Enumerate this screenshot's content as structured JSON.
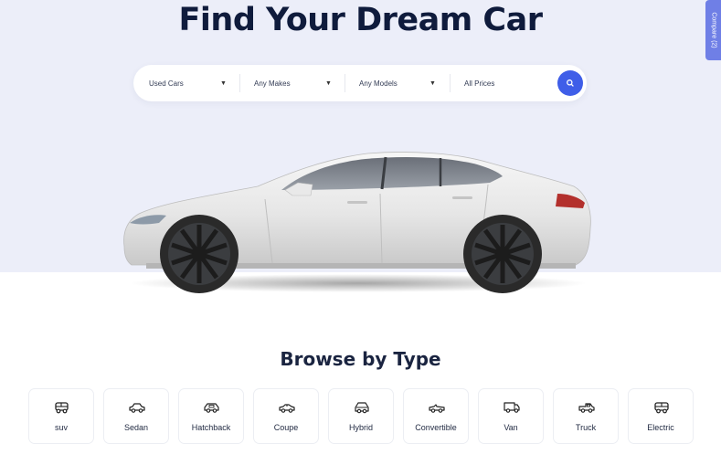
{
  "hero": {
    "title": "Find Your Dream Car"
  },
  "compare_tab": {
    "label": "Compare (2)"
  },
  "search": {
    "condition": "Used Cars",
    "make": "Any Makes",
    "model": "Any Models",
    "price": "All Prices"
  },
  "browse": {
    "title": "Browse by Type",
    "types": [
      {
        "label": "suv",
        "icon": "suv-icon"
      },
      {
        "label": "Sedan",
        "icon": "sedan-icon"
      },
      {
        "label": "Hatchback",
        "icon": "hatchback-icon"
      },
      {
        "label": "Coupe",
        "icon": "coupe-icon"
      },
      {
        "label": "Hybrid",
        "icon": "hybrid-icon"
      },
      {
        "label": "Convertible",
        "icon": "convertible-icon"
      },
      {
        "label": "Van",
        "icon": "van-icon"
      },
      {
        "label": "Truck",
        "icon": "truck-icon"
      },
      {
        "label": "Electric",
        "icon": "electric-icon"
      }
    ]
  },
  "colors": {
    "hero_background": "#eceef9",
    "accent": "#3f5ee8",
    "compare_tab": "#6f7fe6",
    "heading": "#0f1b3c"
  }
}
